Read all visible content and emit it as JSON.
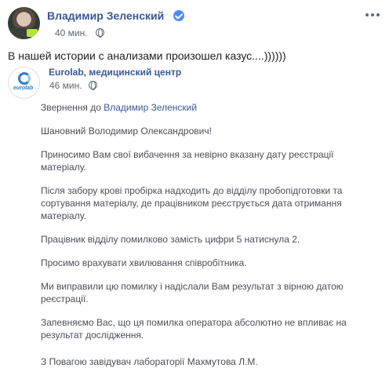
{
  "post": {
    "author": "Владимир Зеленский",
    "time": "40 мин.",
    "text": "В нашей истории с анализами произошел казус....))))))"
  },
  "shared": {
    "page_name": "Eurolab, медицинский центр",
    "logo_text": "eurolab",
    "time": "46 мин."
  },
  "letter": {
    "address_prefix": "Звернення до",
    "address_name": "Владимир Зеленский",
    "greeting": "Шановний Володимир Олександрович!",
    "p1": "Приносимо Вам свої вибачення за невірно вказану дату реєстрації матеріалу.",
    "p2": "Після забору крові пробірка надходить до відділу пробопідготовки та сортування матеріалу, де працівником реєструється дата отримання матеріалу.",
    "p3": "Працівник відділу помилково замість цифри 5 натиснула 2.",
    "p4": "Просимо врахувати хвилювання співробітника.",
    "p5": "Ми виправили цю помилку і надіслали Вам результат з вірною датою реєстрації.",
    "p6": "Запевняємо Вас, що ця помилка оператора абсолютно не впливає на результат дослідження.",
    "signature": "З Повагою завідувач лабораторії Махмутова Л.М."
  },
  "icons": {
    "verified": "verified-badge-icon",
    "privacy": "globe-icon",
    "menu": "more-options-icon"
  },
  "colors": {
    "link": "#385898",
    "meta": "#616770",
    "verified": "#4a8bff"
  }
}
